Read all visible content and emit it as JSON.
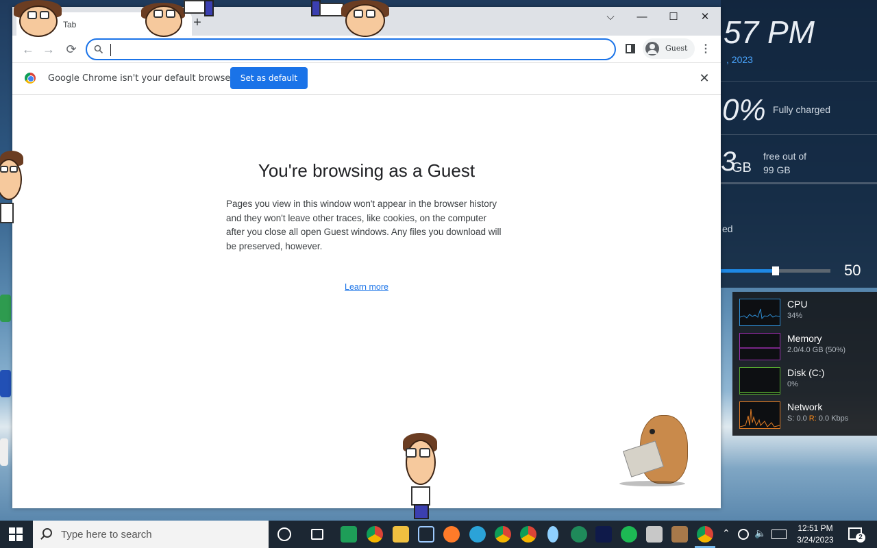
{
  "widgets": {
    "clock": "57 PM",
    "date": ", 2023",
    "battery_percent": "0%",
    "battery_status": "Fully charged",
    "disk_free_num": "3",
    "disk_free_unit": "GB",
    "disk_free_label_1": "free out of",
    "disk_free_label_2": "99 GB",
    "partial_text": "ed",
    "volume_level": 50,
    "volume_label": "50",
    "accent_color": "#1e88e5"
  },
  "perf": [
    {
      "name": "CPU",
      "value": "34%",
      "color": "#2f8fd6"
    },
    {
      "name": "Memory",
      "value": "2.0/4.0 GB (50%)",
      "color": "#9b2fae"
    },
    {
      "name": "Disk (C:)",
      "value": "0%",
      "color": "#55a630"
    },
    {
      "name": "Network",
      "value_s": "S: 0.0 ",
      "value_r_label": "R:",
      "value_r": " 0.0 Kbps",
      "color": "#e07b24"
    }
  ],
  "browser": {
    "tab_title": "Tab",
    "new_tab_symbol": "+",
    "window_controls": {
      "dropdown": "⌵",
      "minimize": "—",
      "maximize": "☐",
      "close": "✕"
    },
    "nav": {
      "back": "←",
      "forward": "→",
      "reload": "⟳"
    },
    "omnibox_value": "",
    "profile_name": "Guest",
    "menu": "⋮",
    "infobar_text": "Google Chrome isn't your default browser",
    "set_default_label": "Set as default",
    "infobar_close": "✕",
    "page_title": "You're browsing as a Guest",
    "page_body": "Pages you view in this window won't appear in the browser history and they won't leave other traces, like cookies, on the computer after you close all open Guest windows. Any files you download will be preserved, however.",
    "learn_more": "Learn more",
    "accent_color": "#1a73e8"
  },
  "taskbar": {
    "search_placeholder": "Type here to search",
    "time": "12:51 PM",
    "date": "3/24/2023",
    "notification_count": "2",
    "icons": [
      "cortana-circle-icon",
      "task-view-icon",
      "sheets-icon",
      "chrome-icon",
      "file-explorer-icon",
      "3d-box-icon",
      "firefox-icon",
      "edge-icon",
      "chrome-profile-icon",
      "chrome-profile-icon",
      "drop-icon",
      "edge-dev-icon",
      "disney-plus-icon",
      "spotify-icon",
      "photo-app-icon",
      "hamster-app-icon",
      "chrome-active-icon"
    ]
  }
}
